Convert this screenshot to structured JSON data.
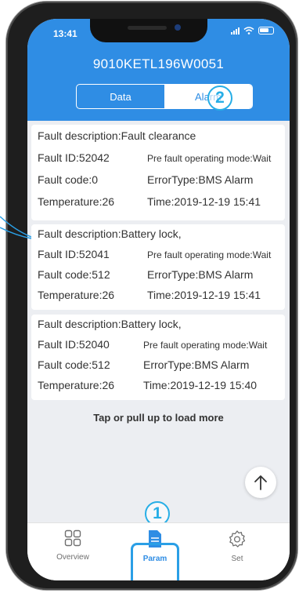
{
  "status_bar": {
    "time": "13:41"
  },
  "header": {
    "device_id": "9010KETL196W0051"
  },
  "tabs": [
    {
      "label": "Data",
      "active": false
    },
    {
      "label": "Alarm",
      "active": true
    }
  ],
  "annotations": {
    "tab_marker": "2",
    "nav_marker": "1"
  },
  "alarms": [
    {
      "description": "Fault description:Fault clearance",
      "fault_id": "Fault ID:52042",
      "pre_mode": "Pre fault operating mode:Wait",
      "fault_code": "Fault code:0",
      "error_type": "ErrorType:BMS Alarm",
      "temperature": "Temperature:26",
      "time": "Time:2019-12-19 15:41"
    },
    {
      "description": "Fault description:Battery lock,",
      "fault_id": "Fault ID:52041",
      "pre_mode": "Pre fault operating mode:Wait",
      "fault_code": "Fault code:512",
      "error_type": "ErrorType:BMS Alarm",
      "temperature": "Temperature:26",
      "time": "Time:2019-12-19 15:41"
    },
    {
      "description": "Fault description:Battery lock,",
      "fault_id": "Fault ID:52040",
      "pre_mode": "Pre fault operating mode:Wait",
      "fault_code": "Fault code:512",
      "error_type": "ErrorType:BMS Alarm",
      "temperature": "Temperature:26",
      "time": "Time:2019-12-19 15:40"
    }
  ],
  "load_more": "Tap or pull up to load more",
  "nav": [
    {
      "label": "Overview",
      "icon": "grid-icon",
      "active": false
    },
    {
      "label": "Param",
      "icon": "document-icon",
      "active": true
    },
    {
      "label": "Set",
      "icon": "gear-icon",
      "active": false
    }
  ],
  "colors": {
    "accent": "#2f8de4",
    "annotation": "#27aee6",
    "background": "#eceef2"
  }
}
